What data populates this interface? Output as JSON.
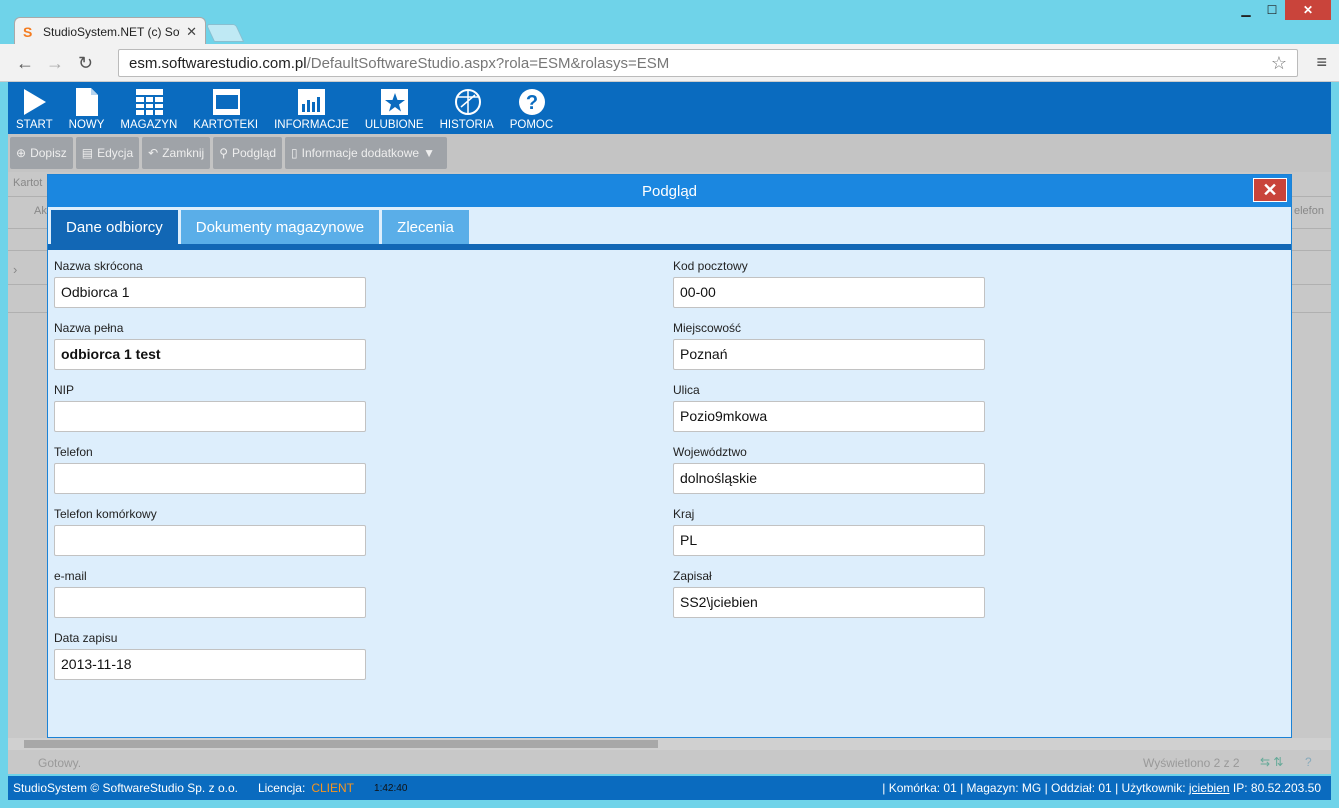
{
  "browser": {
    "tab_title": "StudioSystem.NET (c) Soft",
    "tab_close": "✕",
    "url_main": "esm.softwarestudio.com.pl",
    "url_rest": "/DefaultSoftwareStudio.aspx?rola=ESM&rolasys=ESM"
  },
  "toolbar": {
    "items": [
      {
        "label": "START",
        "icon": "play-icon"
      },
      {
        "label": "NOWY",
        "icon": "document-icon"
      },
      {
        "label": "MAGAZYN",
        "icon": "grid-icon"
      },
      {
        "label": "KARTOTEKI",
        "icon": "window-icon"
      },
      {
        "label": "INFORMACJE",
        "icon": "chart-icon"
      },
      {
        "label": "ULUBIONE",
        "icon": "star-icon"
      },
      {
        "label": "HISTORIA",
        "icon": "history-icon"
      },
      {
        "label": "POMOC",
        "icon": "help-icon"
      }
    ]
  },
  "actions": {
    "dopisz": "Dopisz",
    "edycja": "Edycja",
    "zamknij": "Zamknij",
    "podglad": "Podgląd",
    "info": "Informacje dodatkowe"
  },
  "background": {
    "kartot": "Kartot",
    "ak": "Ak",
    "telefon": "elefon",
    "gotowy": "Gotowy.",
    "wyswietlono": "Wyświetlono 2 z 2"
  },
  "modal": {
    "title": "Podgląd",
    "tabs": [
      "Dane odbiorcy",
      "Dokumenty magazynowe",
      "Zlecenia"
    ],
    "left_fields": [
      {
        "label": "Nazwa skrócona",
        "value": "Odbiorca 1"
      },
      {
        "label": "Nazwa pełna",
        "value": "odbiorca 1 test"
      },
      {
        "label": "NIP",
        "value": ""
      },
      {
        "label": "Telefon",
        "value": ""
      },
      {
        "label": "Telefon komórkowy",
        "value": ""
      },
      {
        "label": "e-mail",
        "value": ""
      },
      {
        "label": "Data zapisu",
        "value": "2013-11-18"
      }
    ],
    "right_fields": [
      {
        "label": "Kod pocztowy",
        "value": "00-00"
      },
      {
        "label": "Miejscowość",
        "value": "Poznań"
      },
      {
        "label": "Ulica",
        "value": "Pozio9mkowa"
      },
      {
        "label": "Województwo",
        "value": "dolnośląskie"
      },
      {
        "label": "Kraj",
        "value": "PL"
      },
      {
        "label": "Zapisał",
        "value": "SS2\\jciebien"
      }
    ]
  },
  "footer": {
    "copyright": "StudioSystem © SoftwareStudio Sp. z o.o.",
    "licencja_label": "Licencja:",
    "licencja_value": "CLIENT",
    "time": "1:42:40",
    "info": "| Komórka: 01 | Magazyn: MG | Oddział: 01 | Użytkownik:",
    "user": "jciebien",
    "ip": "IP: 80.52.203.50"
  },
  "colors": {
    "toolbar": "#0a6bbf",
    "modal_header": "#1b87e0",
    "active_tab": "#1267b5",
    "close": "#c9443b"
  }
}
